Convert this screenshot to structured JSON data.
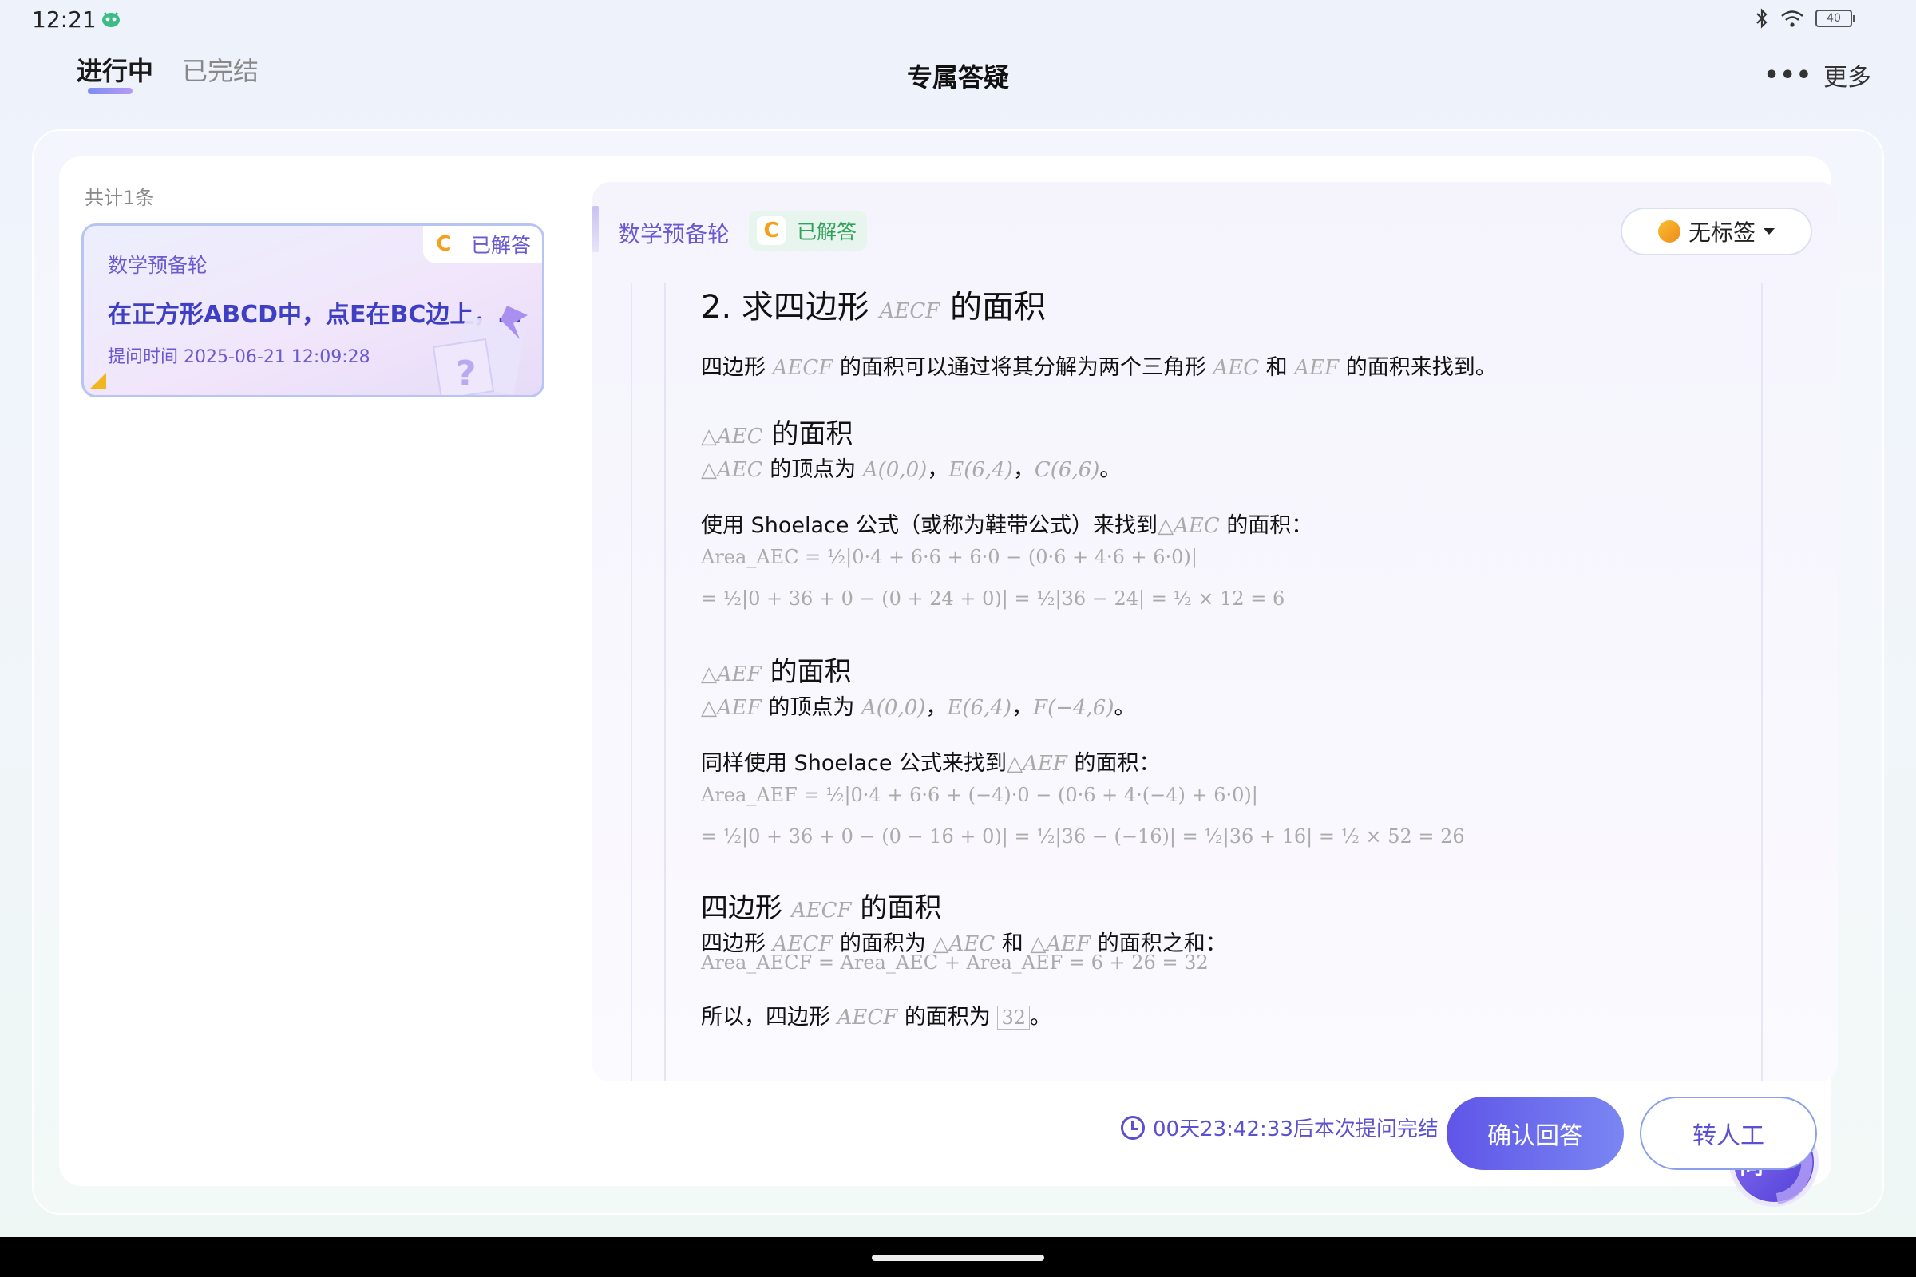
{
  "status_bar": {
    "time": "12:21",
    "battery": "40"
  },
  "tabs": [
    {
      "label": "进行中",
      "active": true
    },
    {
      "label": "已完结",
      "active": false
    }
  ],
  "page_title": "专属答疑",
  "more_label": "更多",
  "list": {
    "total": "共计1条",
    "items": [
      {
        "subject": "数学预备轮",
        "status": "已解答",
        "status_icon": "C",
        "title": "在正方形ABCD中，点E在BC边上，…",
        "time": "提问时间 2025-06-21 12:09:28"
      }
    ]
  },
  "answer": {
    "subject": "数学预备轮",
    "status_icon": "C",
    "status": "已解答",
    "tag_label": "无标签",
    "content": {
      "heading": {
        "pre": "2. 求四边形",
        "math": "AECF",
        "post": "的面积"
      },
      "intro": {
        "t1": "四边形",
        "m1": "AECF",
        "t2": "的面积可以通过将其分解为两个三角形",
        "m2": "AEC",
        "t3": "和",
        "m3": "AEF",
        "t4": "的面积来找到。"
      },
      "sec1_title": {
        "math": "△AEC",
        "text": "的面积"
      },
      "sec1_vertices": {
        "math": "△AEC",
        "t1": "的顶点为",
        "v1": "A(0,0)",
        "sep1": "，",
        "v2": "E(6,4)",
        "sep2": "，",
        "v3": "C(6,6)",
        "end": "。"
      },
      "sec1_method": {
        "t1": "使用 Shoelace 公式（或称为鞋带公式）来找到",
        "math": "△AEC",
        "t2": "的面积："
      },
      "sec1_eq1": "Area_AEC = ½|0·4 + 6·6 + 6·0 − (0·6 + 4·6 + 6·0)|",
      "sec1_eq2": "= ½|0 + 36 + 0 − (0 + 24 + 0)| = ½|36 − 24| = ½ × 12 = 6",
      "sec2_title": {
        "math": "△AEF",
        "text": "的面积"
      },
      "sec2_vertices": {
        "math": "△AEF",
        "t1": "的顶点为",
        "v1": "A(0,0)",
        "sep1": "，",
        "v2": "E(6,4)",
        "sep2": "，",
        "v3": "F(−4,6)",
        "end": "。"
      },
      "sec2_method": {
        "t1": "同样使用 Shoelace 公式来找到",
        "math": "△AEF",
        "t2": "的面积："
      },
      "sec2_eq1": "Area_AEF = ½|0·4 + 6·6 + (−4)·0 − (0·6 + 4·(−4) + 6·0)|",
      "sec2_eq2": "= ½|0 + 36 + 0 − (0 − 16 + 0)| = ½|36 − (−16)| = ½|36 + 16| = ½ × 52 = 26",
      "sec3_title": {
        "pre": "四边形",
        "math": "AECF",
        "post": "的面积"
      },
      "sec3_line": {
        "t1": "四边形",
        "m1": "AECF",
        "t2": "的面积为",
        "m2": "△AEC",
        "t3": "和",
        "m3": "△AEF",
        "t4": "的面积之和："
      },
      "sec3_eq": "Area_AECF = Area_AEC + Area_AEF = 6 + 26 = 32",
      "conclusion": {
        "t1": "所以，四边形",
        "math": "AECF",
        "t2": "的面积为",
        "boxed": "32",
        "end": "。"
      }
    }
  },
  "ask_button_label": "提问",
  "countdown": "00天23:42:33后本次提问完结",
  "confirm_label": "确认回答",
  "human_label": "转人工"
}
